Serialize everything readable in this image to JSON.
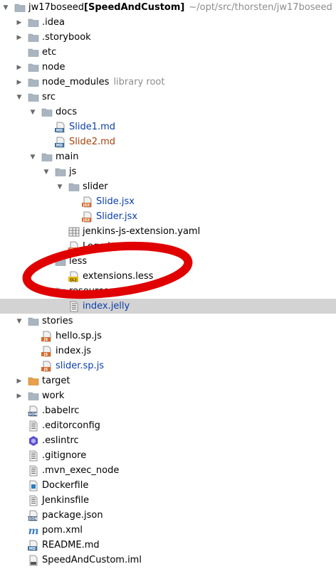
{
  "root": {
    "name": "jw17boseed",
    "module": "[SpeedAndCustom]",
    "path": "~/opt/src/thorsten/jw17boseed"
  },
  "items": [
    {
      "label": "jw17boseed",
      "icon": "folder-icon",
      "depth": 0,
      "arrow": "down"
    },
    {
      "label": ".idea",
      "icon": "folder-icon",
      "depth": 1,
      "arrow": "right"
    },
    {
      "label": ".storybook",
      "icon": "folder-icon",
      "depth": 1,
      "arrow": "right"
    },
    {
      "label": "etc",
      "icon": "folder-icon",
      "depth": 1,
      "arrow": "none"
    },
    {
      "label": "node",
      "icon": "folder-icon",
      "depth": 1,
      "arrow": "right"
    },
    {
      "label": "node_modules",
      "hint": "library root",
      "icon": "folder-icon",
      "depth": 1,
      "arrow": "right"
    },
    {
      "label": "src",
      "icon": "folder-icon",
      "depth": 1,
      "arrow": "down"
    },
    {
      "label": "docs",
      "icon": "folder-icon",
      "depth": 2,
      "arrow": "down"
    },
    {
      "label": "Slide1.md",
      "icon": "md-file-icon",
      "depth": 3,
      "arrow": "none",
      "color": "blue"
    },
    {
      "label": "Slide2.md",
      "icon": "md-file-icon",
      "depth": 3,
      "arrow": "none",
      "color": "brown"
    },
    {
      "label": "main",
      "icon": "folder-icon",
      "depth": 2,
      "arrow": "down"
    },
    {
      "label": "js",
      "icon": "folder-icon",
      "depth": 3,
      "arrow": "down"
    },
    {
      "label": "slider",
      "icon": "folder-icon",
      "depth": 4,
      "arrow": "down"
    },
    {
      "label": "Slide.jsx",
      "icon": "jsx-file-icon",
      "depth": 5,
      "arrow": "none",
      "color": "blue"
    },
    {
      "label": "Slider.jsx",
      "icon": "jsx-file-icon",
      "depth": 5,
      "arrow": "none",
      "color": "blue"
    },
    {
      "label": "jenkins-js-extension.yaml",
      "icon": "yaml-file-icon",
      "depth": 4,
      "arrow": "none"
    },
    {
      "label": "Logo.jsx",
      "icon": "jsx-file-icon",
      "depth": 4,
      "arrow": "none"
    },
    {
      "label": "less",
      "icon": "folder-icon",
      "depth": 3,
      "arrow": "down"
    },
    {
      "label": "extensions.less",
      "icon": "less-file-icon",
      "depth": 4,
      "arrow": "none"
    },
    {
      "label": "resources",
      "icon": "resources-folder-icon",
      "depth": 3,
      "arrow": "down"
    },
    {
      "label": "index.jelly",
      "icon": "text-file-icon",
      "depth": 4,
      "arrow": "none",
      "color": "blue",
      "selected": true
    },
    {
      "label": "stories",
      "icon": "folder-icon",
      "depth": 1,
      "arrow": "down"
    },
    {
      "label": "hello.sp.js",
      "icon": "js-file-icon",
      "depth": 2,
      "arrow": "none"
    },
    {
      "label": "index.js",
      "icon": "js-file-icon",
      "depth": 2,
      "arrow": "none"
    },
    {
      "label": "slider.sp.js",
      "icon": "js-file-icon",
      "depth": 2,
      "arrow": "none",
      "color": "blue"
    },
    {
      "label": "target",
      "icon": "excluded-folder-icon",
      "depth": 1,
      "arrow": "right"
    },
    {
      "label": "work",
      "icon": "folder-icon",
      "depth": 1,
      "arrow": "right"
    },
    {
      "label": ".babelrc",
      "icon": "json-file-icon",
      "depth": 1,
      "arrow": "none"
    },
    {
      "label": ".editorconfig",
      "icon": "text-file-icon",
      "depth": 1,
      "arrow": "none"
    },
    {
      "label": ".eslintrc",
      "icon": "eslint-file-icon",
      "depth": 1,
      "arrow": "none"
    },
    {
      "label": ".gitignore",
      "icon": "text-file-icon",
      "depth": 1,
      "arrow": "none"
    },
    {
      "label": ".mvn_exec_node",
      "icon": "text-file-icon",
      "depth": 1,
      "arrow": "none"
    },
    {
      "label": "Dockerfile",
      "icon": "docker-file-icon",
      "depth": 1,
      "arrow": "none"
    },
    {
      "label": "Jenkinsfile",
      "icon": "text-file-icon",
      "depth": 1,
      "arrow": "none"
    },
    {
      "label": "package.json",
      "icon": "json-file-icon",
      "depth": 1,
      "arrow": "none"
    },
    {
      "label": "pom.xml",
      "icon": "maven-file-icon",
      "depth": 1,
      "arrow": "none"
    },
    {
      "label": "README.md",
      "icon": "md-file-icon",
      "depth": 1,
      "arrow": "none"
    },
    {
      "label": "SpeedAndCustom.iml",
      "icon": "iml-file-icon",
      "depth": 1,
      "arrow": "none"
    }
  ],
  "colors": {
    "vcs_modified_blue": "#0b3ea8",
    "vcs_unversioned_brown": "#a8410b",
    "selection_bg": "#d3d3d3",
    "folder": "#a9b5c1",
    "excluded_folder": "#e8a04a",
    "annotation_red": "#e00000"
  }
}
